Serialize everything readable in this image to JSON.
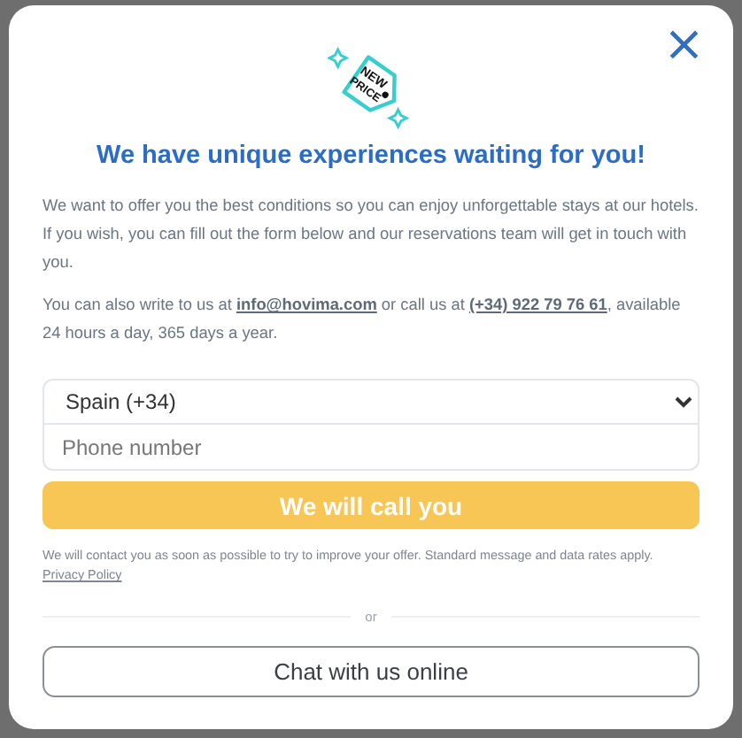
{
  "dialog": {
    "close_icon": "×",
    "badge": {
      "lines": [
        "NEW",
        "PRICE"
      ]
    },
    "title": "We have unique experiences waiting for you!",
    "intro": "We want to offer you the best conditions so you can enjoy unforgettable stays at our hotels. If you wish, you can fill out the form below and our reservations team will get in touch with you.",
    "contact": [
      {
        "kind": "text",
        "text": "You can also write to us at "
      },
      {
        "kind": "link",
        "text": "info@hovima.com"
      },
      {
        "kind": "text",
        "text": " or call us at "
      },
      {
        "kind": "link",
        "text": "(+34) 922 79 76 61"
      },
      {
        "kind": "text",
        "text": ", available 24 hours a day, 365 days a year."
      }
    ],
    "form": {
      "country": "Spain (+34)",
      "phone": {
        "placeholder": "Phone number"
      },
      "submit": "We will call you"
    },
    "disclaimer": "We will contact you as soon as possible to try to improve your offer. Standard message and data rates apply.",
    "privacy_link": "Privacy Policy",
    "separator": "or",
    "chat_button": "Chat with us online"
  }
}
